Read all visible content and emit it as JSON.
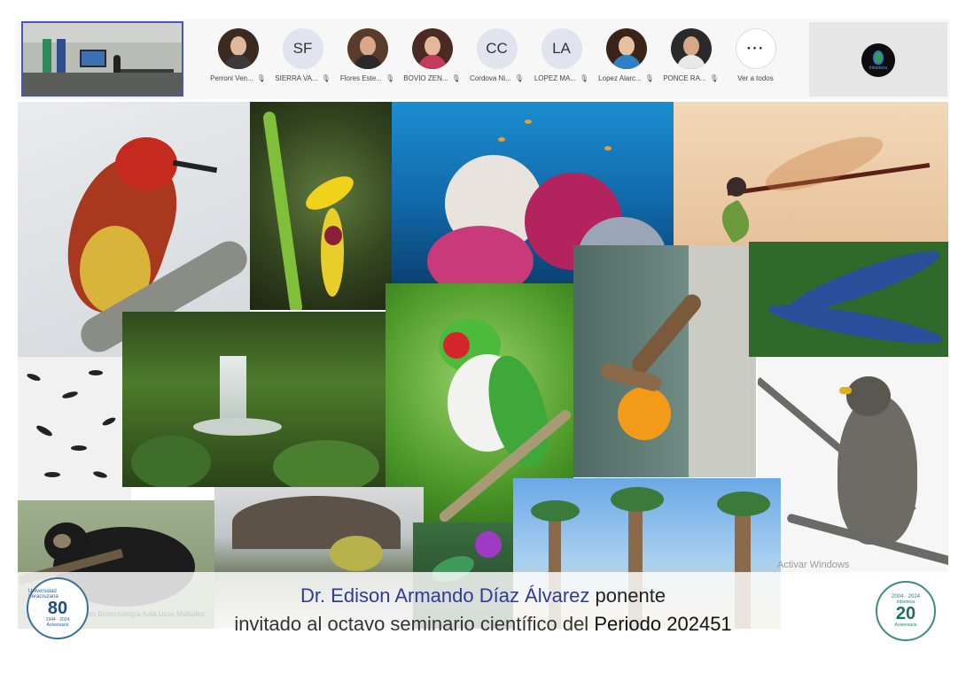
{
  "meeting": {
    "participants": [
      {
        "name": "Perroni Ven...",
        "type": "photo",
        "skin": "#e0b89a",
        "hair": "#3a2a22",
        "shirt": "#3a3a3a"
      },
      {
        "name": "SIERRA VA...",
        "type": "initials",
        "initials": "SF"
      },
      {
        "name": "Flores Este...",
        "type": "photo",
        "skin": "#d9a888",
        "hair": "#5a3a2a",
        "shirt": "#2a2a2a"
      },
      {
        "name": "BOVIO ZEN...",
        "type": "photo",
        "skin": "#e6b89a",
        "hair": "#4a2a22",
        "shirt": "#c43a5a"
      },
      {
        "name": "Cordova Ni...",
        "type": "initials",
        "initials": "CC"
      },
      {
        "name": "LOPEZ MA...",
        "type": "initials",
        "initials": "LA"
      },
      {
        "name": "Lopez Alarc...",
        "type": "photo",
        "skin": "#e8c0a0",
        "hair": "#3a2418",
        "shirt": "#2f7fc4"
      },
      {
        "name": "PONCE RA...",
        "type": "photo",
        "skin": "#d6a886",
        "hair": "#2a2a2a",
        "shirt": "#e8e8e8"
      }
    ],
    "more_label": "Ver a todos",
    "more_glyph": "···",
    "mic_off_glyph": "🎙",
    "logo_tag": "inbioteca"
  },
  "collage": {
    "watermark": "Activar Windows",
    "subcaption": "Instituto Biotecnología Aula Usos Múltiples"
  },
  "banner": {
    "speaker": "Dr. Edison Armando Díaz Álvarez",
    "role": " ponente",
    "line2_prefix": "invitado al octavo seminario científico del ",
    "period": "Periodo 202451"
  },
  "seals": {
    "left": {
      "ring": "Universidad Veracruzana",
      "number": "80",
      "years": "1944 · 2024",
      "label": "Aniversario"
    },
    "right": {
      "ring": "2004 · 2024",
      "number": "20",
      "brand": "inbioteca",
      "label": "Aniversario"
    }
  },
  "colors": {
    "selfview_border": "#4b53bc",
    "speaker_name": "#2f3b9c"
  }
}
